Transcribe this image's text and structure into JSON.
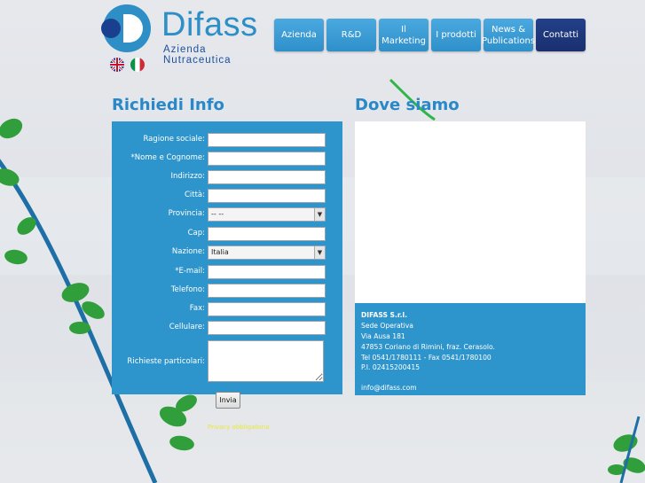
{
  "brand": {
    "name": "Difass",
    "tagline": "Azienda Nutraceutica",
    "colors": {
      "primary": "#2e95cc",
      "dark": "#1a2f6e",
      "heading": "#2a88c8"
    }
  },
  "languages": [
    {
      "icon": "uk-flag-icon"
    },
    {
      "icon": "italy-flag-icon"
    }
  ],
  "nav": {
    "items": [
      {
        "label": "Azienda"
      },
      {
        "label": "R&D"
      },
      {
        "label": "Il Marketing"
      },
      {
        "label": "I prodotti"
      },
      {
        "label": "News & Publications"
      },
      {
        "label": "Contatti",
        "active": true
      }
    ]
  },
  "form": {
    "title": "Richiedi Info",
    "fields": {
      "ragione": {
        "label": "Ragione sociale:",
        "value": ""
      },
      "nome": {
        "label": "*Nome e Cognome:",
        "value": ""
      },
      "indirizzo": {
        "label": "Indirizzo:",
        "value": ""
      },
      "citta": {
        "label": "Città:",
        "value": ""
      },
      "provincia": {
        "label": "Provincia:",
        "selected": "-- --"
      },
      "cap": {
        "label": "Cap:",
        "value": ""
      },
      "nazione": {
        "label": "Nazione:",
        "selected": "Italia"
      },
      "email": {
        "label": "*E-mail:",
        "value": ""
      },
      "telefono": {
        "label": "Telefono:",
        "value": ""
      },
      "fax": {
        "label": "Fax:",
        "value": ""
      },
      "cellulare": {
        "label": "Cellulare:",
        "value": ""
      },
      "richieste": {
        "label": "Richieste particolari:",
        "value": ""
      }
    },
    "submit_label": "Invia",
    "privacy_text": "Privacy obbligatoria"
  },
  "location": {
    "title": "Dove siamo",
    "address": {
      "company": "DIFASS S.r.l.",
      "line1": "Sede Operativa",
      "line2": "Via Ausa 181",
      "line3": "47853 Coriano di Rimini, fraz. Cerasolo.",
      "line4": "Tel 0541/1780111 - Fax 0541/1780100",
      "line5": "P.I. 02415200415",
      "email": "info@difass.com"
    }
  }
}
